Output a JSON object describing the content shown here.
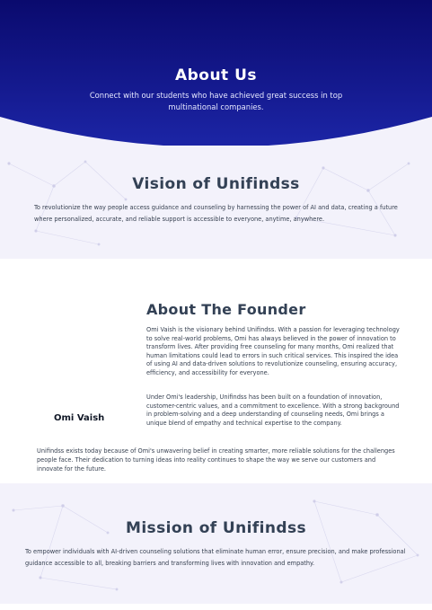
{
  "hero": {
    "title": "About Us",
    "subtitle": "Connect with our students who have achieved great success in top multinational companies."
  },
  "vision": {
    "title": "Vision of Unifindss",
    "text": "To revolutionize the way people access guidance and counseling by harnessing the power of AI and data, creating a future where personalized, accurate, and reliable support is accessible to everyone, anytime, anywhere."
  },
  "founder": {
    "title": "About The Founder",
    "name": "Omi Vaish",
    "paragraph1": "Omi Vaish is the visionary behind Unifindss. With a passion for leveraging technology to solve real-world problems, Omi has always believed in the power of innovation to transform lives. After providing free counseling for many months, Omi realized that human limitations could lead to errors in such critical services. This inspired the idea of using AI and data-driven solutions to revolutionize counseling, ensuring accuracy, efficiency, and accessibility for everyone.",
    "paragraph2": "Under Omi's leadership, Unifindss has been built on a foundation of innovation, customer-centric values, and a commitment to excellence. With a strong background in problem-solving and a deep understanding of counseling needs, Omi brings a unique blend of empathy and technical expertise to the company.",
    "closing": "Unifindss exists today because of Omi's unwavering belief in creating smarter, more reliable solutions for the challenges people face. Their dedication to turning ideas into reality continues to shape the way we serve our customers and innovate for the future."
  },
  "mission": {
    "title": "Mission of Unifindss",
    "text": "To empower individuals with AI-driven counseling solutions that eliminate human error, ensure precision, and make professional guidance accessible to all, breaking barriers and transforming lives with innovation and empathy."
  },
  "colors": {
    "hero_dark": "#0a0a6e",
    "hero_mid": "#1c25a6",
    "section_bg": "#f3f2fb",
    "heading": "#334155"
  }
}
